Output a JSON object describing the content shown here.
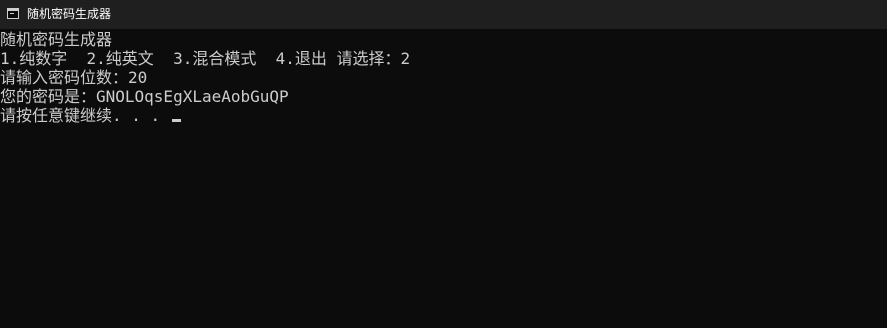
{
  "window": {
    "title": "随机密码生成器",
    "icon": "console-app-icon"
  },
  "console": {
    "lines": [
      "随机密码生成器",
      "1.纯数字  2.纯英文  3.混合模式  4.退出 请选择：2",
      "请输入密码位数：20",
      "您的密码是：GNOLOqsEgXLaeAobGuQP",
      "请按任意键继续. . . "
    ]
  },
  "colors": {
    "background": "#0c0c0c",
    "titlebar": "#1f1f1f",
    "text": "#cccccc"
  }
}
